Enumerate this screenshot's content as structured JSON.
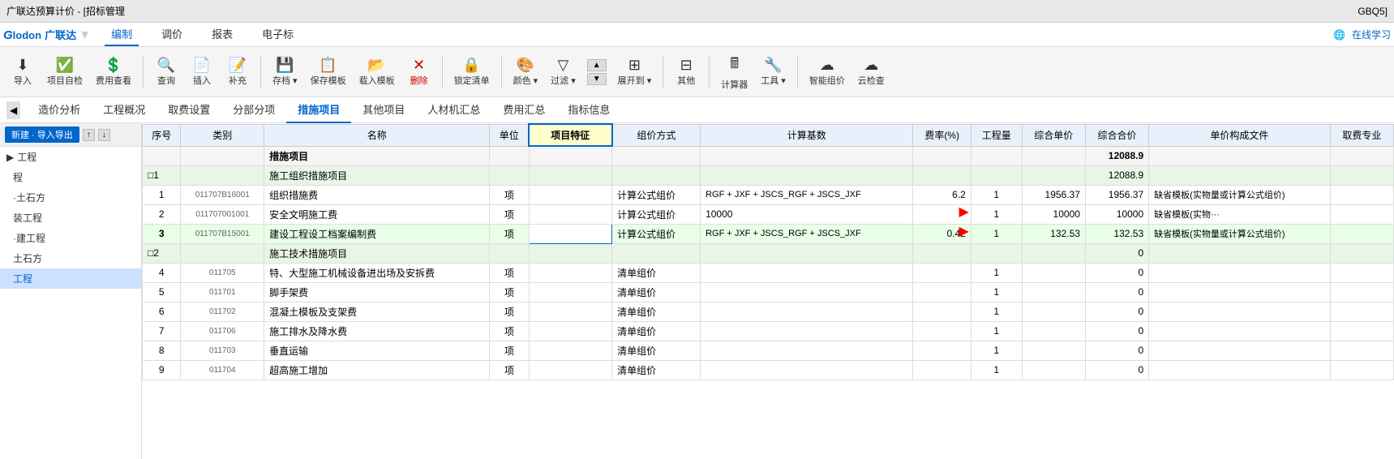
{
  "titleBar": {
    "title": "广联达预算计价 - [招标管理",
    "right": "GBQ5]"
  },
  "menuBar": {
    "logo": "GLODON广联达",
    "items": [
      "编制",
      "调价",
      "报表",
      "电子标"
    ],
    "activeItem": "编制",
    "rightItems": [
      "在线学习"
    ]
  },
  "toolbar": {
    "buttons": [
      {
        "label": "导入",
        "icon": "⬇"
      },
      {
        "label": "项目自检",
        "icon": "✓"
      },
      {
        "label": "费用查看",
        "icon": "👁"
      },
      {
        "label": "查询",
        "icon": "🔍"
      },
      {
        "label": "插入",
        "icon": "➕"
      },
      {
        "label": "补充",
        "icon": "📝"
      },
      {
        "label": "存档▾",
        "icon": "💾"
      },
      {
        "label": "保存模板",
        "icon": "📋"
      },
      {
        "label": "载入模板",
        "icon": "📂"
      },
      {
        "label": "✕ 删除",
        "icon": ""
      },
      {
        "label": "锁定清单",
        "icon": "🔒"
      },
      {
        "label": "颜色▾",
        "icon": "🎨"
      },
      {
        "label": "过滤▾",
        "icon": "▼"
      },
      {
        "label": "展开到▾",
        "icon": "⬇"
      },
      {
        "label": "其他",
        "icon": "⊞"
      },
      {
        "label": "计算器",
        "icon": "🖩"
      },
      {
        "label": "工具▾",
        "icon": "🔧"
      },
      {
        "label": "智能组价",
        "icon": "☁"
      },
      {
        "label": "云检查",
        "icon": "☁"
      }
    ]
  },
  "tabs": {
    "items": [
      "造价分析",
      "工程概况",
      "取费设置",
      "分部分项",
      "措施项目",
      "其他项目",
      "人材机汇总",
      "费用汇总",
      "指标信息"
    ],
    "activeTab": "措施项目"
  },
  "sidebar": {
    "newBtn": "新建 · 导入导出",
    "navUp": "↑",
    "navDown": "↓",
    "items": [
      {
        "label": "工程",
        "level": 1,
        "active": false
      },
      {
        "label": "程",
        "level": 2,
        "active": false
      },
      {
        "label": "土石方",
        "level": 2,
        "active": false
      },
      {
        "label": "装工程",
        "level": 2,
        "active": false
      },
      {
        "label": "建工程",
        "level": 2,
        "active": false
      },
      {
        "label": "土石方",
        "level": 2,
        "active": false
      },
      {
        "label": "工程",
        "level": 2,
        "active": true
      }
    ]
  },
  "table": {
    "columns": [
      "序号",
      "类别",
      "名称",
      "单位",
      "项目特征",
      "组价方式",
      "计算基数",
      "费率(%)",
      "工程量",
      "综合单价",
      "综合合价",
      "单价构成文件",
      "取费专业"
    ],
    "highlightCol": "项目特征",
    "rows": [
      {
        "type": "header",
        "seq": "",
        "category": "",
        "name": "措施项目",
        "unit": "",
        "feature": "",
        "method": "",
        "base": "",
        "rate": "",
        "qty": "",
        "unitPrice": "",
        "totalPrice": "12088.9",
        "priceFile": "",
        "profession": ""
      },
      {
        "type": "section",
        "seq": "□1",
        "category": "",
        "name": "施工组织措施项目",
        "unit": "",
        "feature": "",
        "method": "",
        "base": "",
        "rate": "",
        "qty": "",
        "unitPrice": "",
        "totalPrice": "12088.9",
        "priceFile": "",
        "profession": ""
      },
      {
        "type": "normal",
        "seq": "1",
        "category": "",
        "name": "组织措施费",
        "unit": "项",
        "feature": "",
        "method": "计算公式组价",
        "base": "RGF + JXF + JSCS_RGF + JSCS_JXF",
        "rate": "6.2",
        "qty": "1",
        "unitPrice": "1956.37",
        "totalPrice": "1956.37",
        "priceFile": "缺省模板(实物量或计算公式组价)",
        "profession": "",
        "code": "011707B16001"
      },
      {
        "type": "normal",
        "seq": "2",
        "category": "",
        "name": "安全文明施工费",
        "unit": "项",
        "feature": "",
        "method": "计算公式组价",
        "base": "10000",
        "rate": "",
        "qty": "1",
        "unitPrice": "10000",
        "totalPrice": "10000",
        "priceFile": "缺省模板(实物···",
        "profession": "",
        "code": "011707001001"
      },
      {
        "type": "selected",
        "seq": "3",
        "category": "",
        "name": "建设工程设工档案编制费",
        "unit": "项",
        "feature": "",
        "method": "计算公式组价",
        "base": "RGF + JXF + JSCS_RGF + JSCS_JXF",
        "rate": "0.42",
        "qty": "1",
        "unitPrice": "132.53",
        "totalPrice": "132.53",
        "priceFile": "缺省模板(实物量或计算公式组价)",
        "profession": "",
        "code": "011707B15001"
      },
      {
        "type": "section2",
        "seq": "□2",
        "category": "",
        "name": "施工技术措施项目",
        "unit": "",
        "feature": "",
        "method": "",
        "base": "",
        "rate": "",
        "qty": "",
        "unitPrice": "",
        "totalPrice": "0",
        "priceFile": "",
        "profession": ""
      },
      {
        "type": "normal2",
        "seq": "4",
        "category": "",
        "name": "特、大型施工机械设备进出场及安拆费",
        "unit": "项",
        "feature": "",
        "method": "清单组价",
        "base": "",
        "rate": "",
        "qty": "1",
        "unitPrice": "",
        "totalPrice": "0",
        "priceFile": "",
        "profession": "",
        "code": "011705"
      },
      {
        "type": "normal2",
        "seq": "5",
        "category": "",
        "name": "脚手架费",
        "unit": "项",
        "feature": "",
        "method": "清单组价",
        "base": "",
        "rate": "",
        "qty": "1",
        "unitPrice": "",
        "totalPrice": "0",
        "priceFile": "",
        "profession": "",
        "code": "011701"
      },
      {
        "type": "normal2",
        "seq": "6",
        "category": "",
        "name": "混凝土模板及支架费",
        "unit": "项",
        "feature": "",
        "method": "清单组价",
        "base": "",
        "rate": "",
        "qty": "1",
        "unitPrice": "",
        "totalPrice": "0",
        "priceFile": "",
        "profession": "",
        "code": "011702"
      },
      {
        "type": "normal2",
        "seq": "7",
        "category": "",
        "name": "施工排水及降水费",
        "unit": "项",
        "feature": "",
        "method": "清单组价",
        "base": "",
        "rate": "",
        "qty": "1",
        "unitPrice": "",
        "totalPrice": "0",
        "priceFile": "",
        "profession": "",
        "code": "011706"
      },
      {
        "type": "normal2",
        "seq": "8",
        "category": "",
        "name": "垂直运输",
        "unit": "项",
        "feature": "",
        "method": "清单组价",
        "base": "",
        "rate": "",
        "qty": "1",
        "unitPrice": "",
        "totalPrice": "0",
        "priceFile": "",
        "profession": "",
        "code": "011703"
      },
      {
        "type": "normal2",
        "seq": "9",
        "category": "",
        "name": "超高施工增加",
        "unit": "项",
        "feature": "",
        "method": "清单组价",
        "base": "",
        "rate": "",
        "qty": "1",
        "unitPrice": "",
        "totalPrice": "0",
        "priceFile": "",
        "profession": "",
        "code": "011704"
      }
    ]
  },
  "icons": {
    "import": "⬇",
    "check": "✓",
    "view": "👁",
    "search": "🔍",
    "insert": "➕",
    "save": "💾",
    "template": "📋",
    "load": "📂",
    "delete": "✕",
    "lock": "🔒",
    "color": "🎨",
    "filter": "▼",
    "expand": "⬇",
    "other": "⊞",
    "calculator": "🖩",
    "tool": "🔧",
    "cloud": "☁",
    "online": "🌐",
    "collapse": "◀",
    "arrow_up": "▲",
    "arrow_down": "▼",
    "minus": "−",
    "red_arrow": "➜"
  }
}
